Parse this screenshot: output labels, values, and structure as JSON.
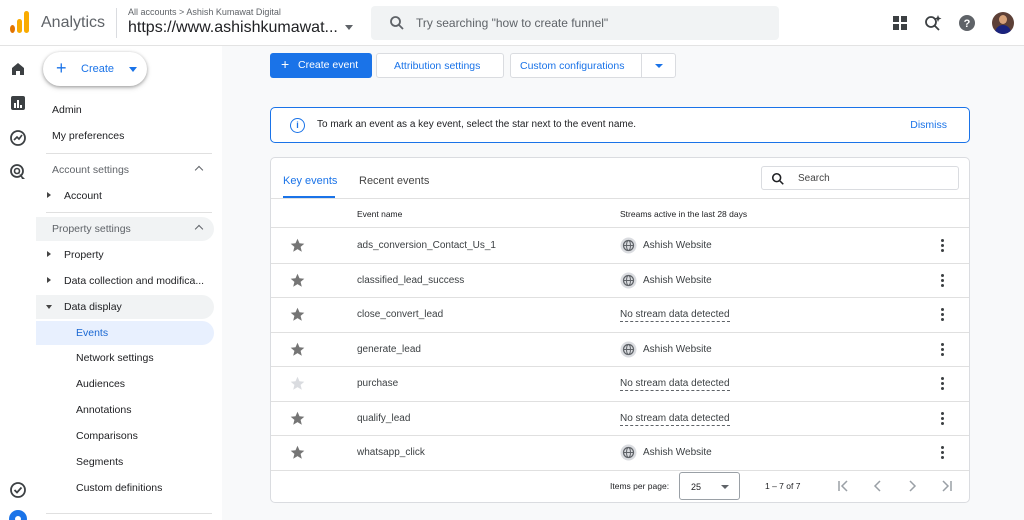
{
  "header": {
    "app_name": "Analytics",
    "breadcrumb_root": "All accounts",
    "breadcrumb_sep": ">",
    "account_name": "Ashish Kumawat Digital",
    "property_name": "https://www.ashishkumawat...",
    "search_placeholder": "Try searching \"how to create funnel\""
  },
  "sidenav": {
    "create_label": "Create",
    "admin_label": "Admin",
    "preferences_label": "My preferences",
    "account_settings_label": "Account settings",
    "account_label": "Account",
    "property_settings_label": "Property settings",
    "property_label": "Property",
    "data_collection_label": "Data collection and modifica...",
    "data_display_label": "Data display",
    "sub_items": [
      "Events",
      "Network settings",
      "Audiences",
      "Annotations",
      "Comparisons",
      "Segments",
      "Custom definitions"
    ]
  },
  "toolbar": {
    "create_event_label": "Create event",
    "attribution_label": "Attribution settings",
    "custom_config_label": "Custom configurations"
  },
  "banner": {
    "message": "To mark an event as a key event, select the star next to the event name.",
    "dismiss_label": "Dismiss"
  },
  "table": {
    "tabs": [
      "Key events",
      "Recent events"
    ],
    "search_placeholder": "Search",
    "col_event": "Event name",
    "col_streams": "Streams active in the last 28 days",
    "rows": [
      {
        "name": "ads_conversion_Contact_Us_1",
        "stream": "Ashish Website",
        "has_stream": true,
        "starred": true
      },
      {
        "name": "classified_lead_success",
        "stream": "Ashish Website",
        "has_stream": true,
        "starred": true
      },
      {
        "name": "close_convert_lead",
        "stream": "No stream data detected",
        "has_stream": false,
        "starred": true
      },
      {
        "name": "generate_lead",
        "stream": "Ashish Website",
        "has_stream": true,
        "starred": true
      },
      {
        "name": "purchase",
        "stream": "No stream data detected",
        "has_stream": false,
        "starred": false
      },
      {
        "name": "qualify_lead",
        "stream": "No stream data detected",
        "has_stream": false,
        "starred": true
      },
      {
        "name": "whatsapp_click",
        "stream": "Ashish Website",
        "has_stream": true,
        "starred": true
      }
    ]
  },
  "pager": {
    "items_per_page_label": "Items per page:",
    "items_per_page_value": "25",
    "range": "1 – 7 of 7"
  },
  "colors": {
    "accent": "#1a73e8",
    "star_active": "#757575",
    "star_inactive": "#dadce0"
  }
}
